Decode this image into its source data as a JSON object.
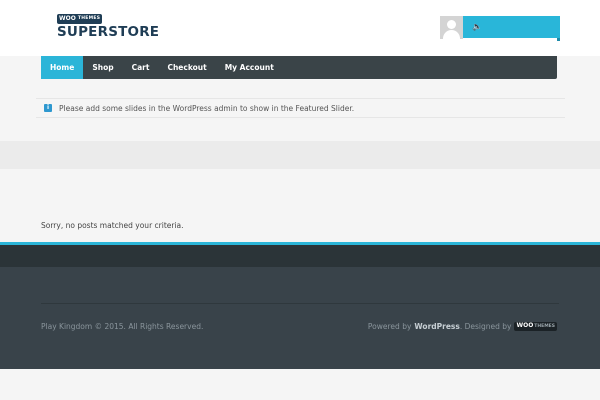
{
  "logo": {
    "badge_woo": "WOO",
    "badge_themes": "THEMES",
    "name": "SUPERSTORE"
  },
  "header": {
    "user_icon": "user-avatar-icon",
    "speaker_icon": "speaker-icon",
    "speaker_glyph": "🔈"
  },
  "nav": {
    "items": [
      {
        "label": "Home",
        "active": true
      },
      {
        "label": "Shop"
      },
      {
        "label": "Cart"
      },
      {
        "label": "Checkout"
      },
      {
        "label": "My Account"
      }
    ]
  },
  "notice": {
    "icon": "info-icon",
    "icon_glyph": "i",
    "text": "Please add some slides in the WordPress admin to show in the Featured Slider."
  },
  "content": {
    "message": "Sorry, no posts matched your criteria."
  },
  "footer": {
    "copyright": "Play Kingdom © 2015. All Rights Reserved.",
    "powered_prefix": "Powered by",
    "powered_link": "WordPress",
    "designed_by": ". Designed by",
    "woo_badge": "WOO",
    "woo_badge_themes": "THEMES"
  },
  "colors": {
    "accent": "#2bb5d8",
    "nav_bg": "#3a4448",
    "footer_bg": "#39434a",
    "logo_text": "#1f3d55"
  }
}
